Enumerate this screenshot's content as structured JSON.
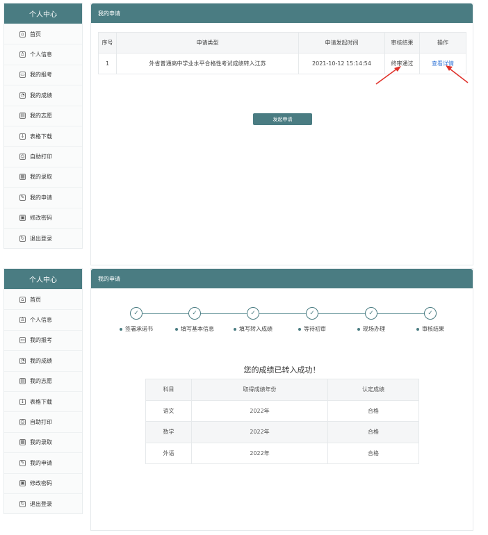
{
  "sidebar": {
    "title": "个人中心",
    "items": [
      {
        "label": "首页",
        "icon": "home-icon",
        "glyph": "⌂"
      },
      {
        "label": "个人信息",
        "icon": "user-icon",
        "glyph": "♙"
      },
      {
        "label": "我的报考",
        "icon": "id-card-icon",
        "glyph": "▭"
      },
      {
        "label": "我的成绩",
        "icon": "pie-chart-icon",
        "glyph": "◔"
      },
      {
        "label": "我的志愿",
        "icon": "document-icon",
        "glyph": "▤"
      },
      {
        "label": "表格下载",
        "icon": "download-icon",
        "glyph": "↓"
      },
      {
        "label": "自助打印",
        "icon": "printer-icon",
        "glyph": "⎙"
      },
      {
        "label": "我的录取",
        "icon": "calendar-icon",
        "glyph": "▦"
      },
      {
        "label": "我的申请",
        "icon": "edit-icon",
        "glyph": "✎"
      },
      {
        "label": "修改密码",
        "icon": "lock-icon",
        "glyph": "▣"
      },
      {
        "label": "退出登录",
        "icon": "logout-icon",
        "glyph": "↻"
      }
    ]
  },
  "top_panel": {
    "title": "我的申请",
    "table": {
      "headers": [
        "序号",
        "申请类型",
        "申请发起时间",
        "审核结果",
        "操作"
      ],
      "rows": [
        {
          "index": "1",
          "type": "外省普通高中学业水平合格性考试成绩转入江苏",
          "time": "2021-10-12 15:14:54",
          "result": "终审通过",
          "action": "查看详情"
        }
      ]
    },
    "apply_button": "发起申请"
  },
  "bottom_panel": {
    "title": "我的申请",
    "steps": [
      "签署承诺书",
      "填写基本信息",
      "填写转入成绩",
      "等待初审",
      "现场办理",
      "审核结果"
    ],
    "success_message": "您的成绩已转入成功！",
    "table": {
      "headers": [
        "科目",
        "取得成绩年份",
        "认定成绩"
      ],
      "rows": [
        [
          "语文",
          "2022年",
          "合格"
        ],
        [
          "数学",
          "2022年",
          "合格"
        ],
        [
          "外语",
          "2022年",
          "合格"
        ]
      ]
    }
  },
  "colors": {
    "primary": "#4a7c82",
    "link": "#3b7bd8",
    "arrow": "#e0322b"
  }
}
